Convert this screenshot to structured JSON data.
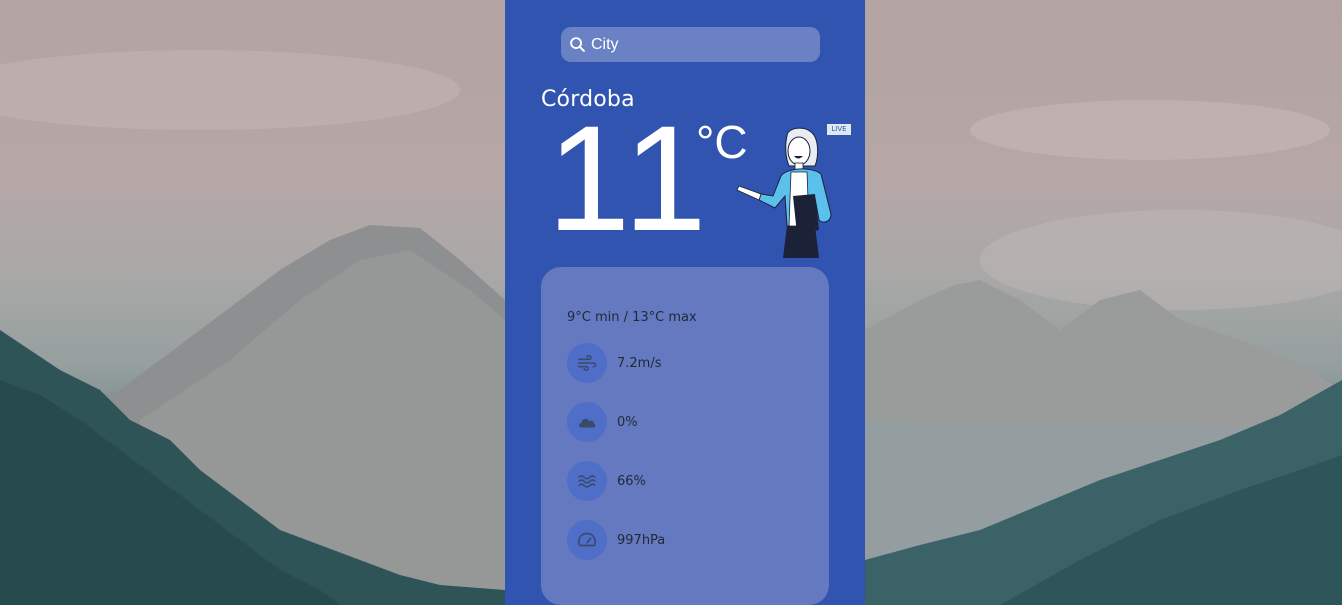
{
  "search": {
    "placeholder": "City"
  },
  "weather": {
    "city": "Córdoba",
    "temperature": "11",
    "unit": "°C",
    "badge": "LIVE",
    "min_max": "9°C min / 13°C max",
    "wind": "7.2m/s",
    "clouds": "0%",
    "humidity": "66%",
    "pressure": "997hPa"
  },
  "icons": {
    "search": "search-icon",
    "wind": "wind-icon",
    "cloud": "cloud-icon",
    "humidity": "waves-icon",
    "pressure": "gauge-icon"
  },
  "colors": {
    "panel": "#3154b0",
    "card": "#6479bf",
    "icon_circle": "#4f6ec8",
    "search_bg": "#6a82c4"
  }
}
